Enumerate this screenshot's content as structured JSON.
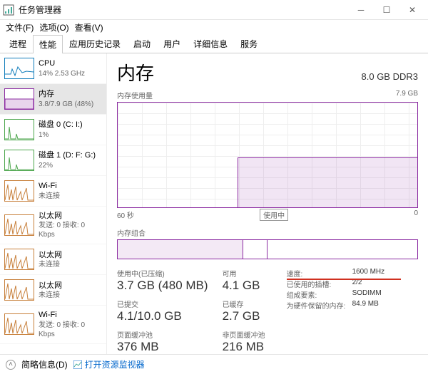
{
  "window": {
    "title": "任务管理器"
  },
  "menu": {
    "file": "文件(F)",
    "options": "选项(O)",
    "view": "查看(V)"
  },
  "tabs": [
    "进程",
    "性能",
    "应用历史记录",
    "启动",
    "用户",
    "详细信息",
    "服务"
  ],
  "active_tab_index": 1,
  "sidebar": {
    "items": [
      {
        "label": "CPU",
        "sub": "14% 2.53 GHz",
        "color": "#117dbb",
        "kind": "cpu"
      },
      {
        "label": "内存",
        "sub": "3.8/7.9 GB (48%)",
        "color": "#8b2aa1",
        "kind": "mem",
        "active": true
      },
      {
        "label": "磁盘 0 (C: I:)",
        "sub": "1%",
        "color": "#4ca64c",
        "kind": "disk"
      },
      {
        "label": "磁盘 1 (D: F: G:)",
        "sub": "22%",
        "color": "#4ca64c",
        "kind": "disk"
      },
      {
        "label": "Wi-Fi",
        "sub": "未连接",
        "color": "#c77f3a",
        "kind": "net"
      },
      {
        "label": "以太网",
        "sub": "发送: 0 接收: 0 Kbps",
        "color": "#c77f3a",
        "kind": "net"
      },
      {
        "label": "以太网",
        "sub": "未连接",
        "color": "#c77f3a",
        "kind": "net"
      },
      {
        "label": "以太网",
        "sub": "未连接",
        "color": "#c77f3a",
        "kind": "net"
      },
      {
        "label": "Wi-Fi",
        "sub": "发送: 0 接收: 0 Kbps",
        "color": "#c77f3a",
        "kind": "net"
      }
    ]
  },
  "main": {
    "title": "内存",
    "spec": "8.0 GB DDR3",
    "usage_label": "内存使用量",
    "usage_max": "7.9 GB",
    "axis_left": "60 秒",
    "axis_mid": "使用中",
    "axis_right": "0",
    "composition_label": "内存组合",
    "stats": {
      "inuse_label": "使用中(已压缩)",
      "inuse_val": "3.7 GB (480 MB)",
      "avail_label": "可用",
      "avail_val": "4.1 GB",
      "commit_label": "已提交",
      "commit_val": "4.1/10.0 GB",
      "cached_label": "已缓存",
      "cached_val": "2.7 GB",
      "paged_label": "页面缓冲池",
      "paged_val": "376 MB",
      "nonpaged_label": "非页面缓冲池",
      "nonpaged_val": "216 MB"
    },
    "details": {
      "speed_k": "速度:",
      "speed_v": "1600 MHz",
      "slots_k": "已使用的插槽:",
      "slots_v": "2/2",
      "form_k": "组成要素:",
      "form_v": "SODIMM",
      "hw_k": "为硬件保留的内存:",
      "hw_v": "84.9 MB"
    }
  },
  "footer": {
    "brief": "简略信息(D)",
    "link": "打开资源监视器"
  },
  "chart_data": {
    "type": "area",
    "title": "内存使用量",
    "ylabel": "GB",
    "ylim": [
      0,
      7.9
    ],
    "x": [
      60,
      55,
      50,
      45,
      40,
      35,
      30,
      25,
      20,
      15,
      10,
      5,
      0
    ],
    "values": [
      0,
      0,
      0,
      0,
      0,
      3.8,
      3.8,
      3.7,
      3.8,
      3.8,
      3.8,
      3.8,
      3.8
    ]
  }
}
